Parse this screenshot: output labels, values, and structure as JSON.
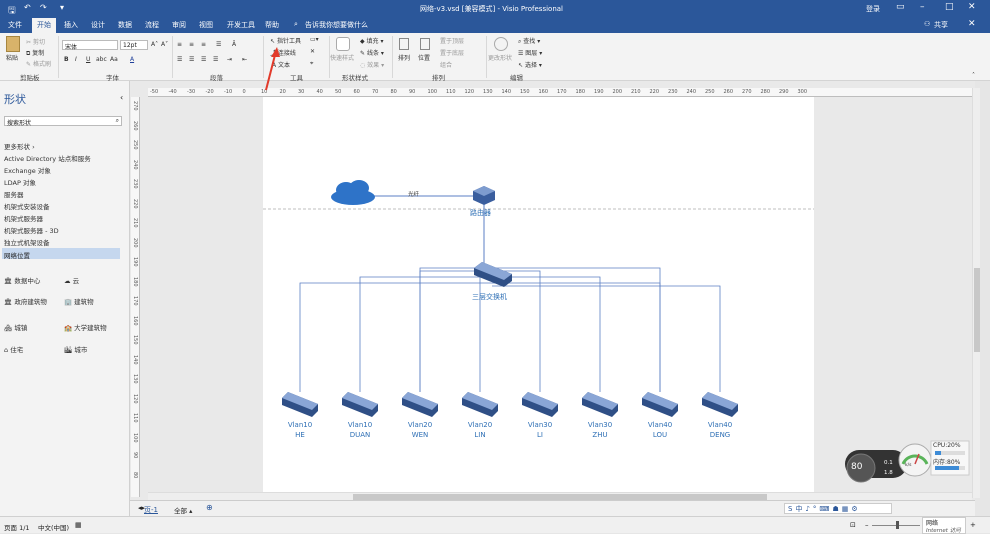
{
  "title": "网络-v3.vsd [兼容模式] - Visio Professional",
  "account": "登录",
  "share": "共享",
  "menu": [
    "文件",
    "开始",
    "插入",
    "设计",
    "数据",
    "流程",
    "审阅",
    "视图",
    "开发工具",
    "帮助"
  ],
  "search_hint": "告诉我你想要做什么",
  "ribbon": {
    "clipboard": {
      "paste": "粘贴",
      "cut": "剪切",
      "copy": "复制",
      "format_painter": "格式刷",
      "group": "剪贴板"
    },
    "font": {
      "name": "宋体",
      "size": "12pt",
      "group": "字体"
    },
    "paragraph": {
      "group": "段落"
    },
    "tools": {
      "pointer": "指针工具",
      "connector": "连接线",
      "text": "文本",
      "group": "工具"
    },
    "shape_styles": {
      "quick_styles": "快速样式",
      "fill": "填充",
      "line": "线条",
      "effects": "效果",
      "group": "形状样式"
    },
    "arrange": {
      "align": "排列",
      "position": "位置",
      "bring_front": "置于顶层",
      "send_back": "置于底层",
      "group_btn": "组合",
      "group": "排列"
    },
    "editing": {
      "change_shape": "更改形状",
      "find": "查找",
      "layers": "图层",
      "select": "选择",
      "group": "编辑"
    }
  },
  "shapes_panel": {
    "title": "形状",
    "search_placeholder": "搜索形状",
    "more_shapes": "更多形状",
    "stencils": [
      "Active Directory 站点和服务",
      "Exchange 对象",
      "LDAP 对象",
      "服务器",
      "机架式安装设备",
      "机架式服务器",
      "机架式服务器 - 3D",
      "独立式机架设备",
      "网络位置"
    ],
    "shapes": [
      "数据中心",
      "云",
      "政府建筑物",
      "建筑物",
      "城镇",
      "大学建筑物",
      "住宅",
      "城市"
    ]
  },
  "ruler_h": [
    "-50",
    "-40",
    "-30",
    "-20",
    "-10",
    "0",
    "10",
    "20",
    "30",
    "40",
    "50",
    "60",
    "70",
    "80",
    "90",
    "100",
    "110",
    "120",
    "130",
    "140",
    "150",
    "160",
    "170",
    "180",
    "190",
    "200",
    "210",
    "220",
    "230",
    "240",
    "250",
    "260",
    "270",
    "280",
    "290",
    "300"
  ],
  "ruler_v": [
    "270",
    "260",
    "250",
    "240",
    "230",
    "220",
    "210",
    "200",
    "190",
    "180",
    "170",
    "160",
    "150",
    "140",
    "130",
    "120",
    "110",
    "100",
    "90",
    "80"
  ],
  "diagram": {
    "link_label": "光纤",
    "router": "路由器",
    "core_switch": "三层交换机",
    "switches": [
      {
        "vlan": "Vlan10",
        "name": "HE"
      },
      {
        "vlan": "Vlan10",
        "name": "DUAN"
      },
      {
        "vlan": "Vlan20",
        "name": "WEN"
      },
      {
        "vlan": "Vlan20",
        "name": "LIN"
      },
      {
        "vlan": "Vlan30",
        "name": "LI"
      },
      {
        "vlan": "Vlan30",
        "name": "ZHU"
      },
      {
        "vlan": "Vlan40",
        "name": "LOU"
      },
      {
        "vlan": "Vlan40",
        "name": "DENG"
      }
    ]
  },
  "page_tabs": {
    "page": "页-1",
    "all": "全部"
  },
  "status": {
    "page": "页面 1/1",
    "lang": "中文(中国)"
  },
  "sysmon": {
    "gauge": "80",
    "cpu": "CPU:20%",
    "mem": "内存:80%",
    "up": "0.1",
    "down": "1.8",
    "speed_unit": "k/s"
  },
  "tray": {
    "network": "网络",
    "internet": "Internet 访问"
  },
  "colors": {
    "accent": "#2b579a",
    "link": "#2e6fb5",
    "line": "#5b7fc4"
  }
}
